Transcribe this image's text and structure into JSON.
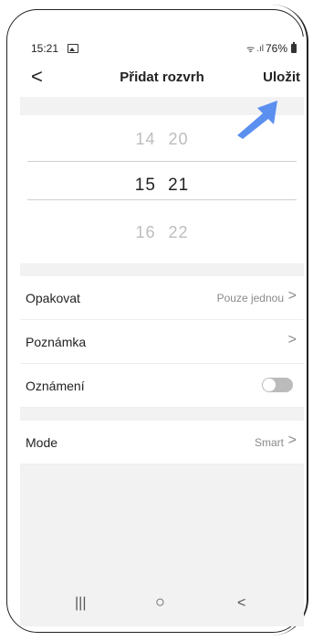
{
  "status": {
    "time": "15:21",
    "battery": "76%"
  },
  "header": {
    "back": "<",
    "title": "Přidat rozvrh",
    "save": "Uložit"
  },
  "picker": {
    "above": {
      "hour": "14",
      "minute": "20"
    },
    "selected": {
      "hour": "15",
      "minute": "21"
    },
    "below": {
      "hour": "16",
      "minute": "22"
    }
  },
  "rows": {
    "repeat": {
      "label": "Opakovat",
      "value": "Pouze jednou"
    },
    "note": {
      "label": "Poznámka"
    },
    "notification": {
      "label": "Oznámení",
      "enabled": false
    },
    "mode": {
      "label": "Mode",
      "value": "Smart"
    }
  },
  "nav": {
    "recent": "|||",
    "home": "○",
    "back": "<"
  },
  "colors": {
    "arrow": "#5b8ff0",
    "background_gray": "#f2f2f2"
  }
}
